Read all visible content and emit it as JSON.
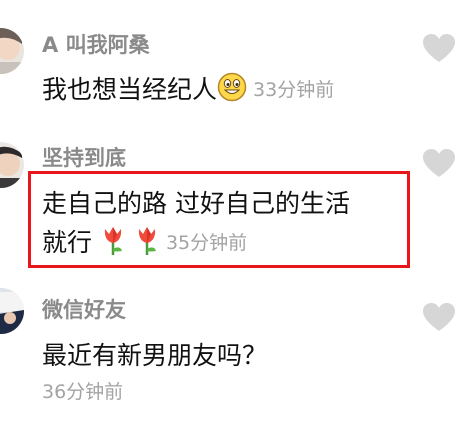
{
  "comments": [
    {
      "username": "A 叫我阿桑",
      "text_lines": [
        "我也想当经纪人"
      ],
      "emoji": [
        "grinning-face-emoji"
      ],
      "time": "33分钟前"
    },
    {
      "username": "坚持到底",
      "text_lines": [
        "走自己的路 过好自己的生活",
        "就行"
      ],
      "emoji": [
        "tulip-emoji",
        "tulip-emoji"
      ],
      "time": "35分钟前",
      "highlighted": true,
      "highlight_color": "#e8151b"
    },
    {
      "username": "微信好友",
      "text_lines": [
        "最近有新男朋友吗？"
      ],
      "time": "36分钟前"
    }
  ],
  "icons": {
    "like": "heart-icon"
  },
  "colors": {
    "username": "#8a8a8a",
    "text": "#111111",
    "time": "#a3a3a3",
    "heart": "#d6d6d6",
    "highlight": "#e8151b"
  }
}
